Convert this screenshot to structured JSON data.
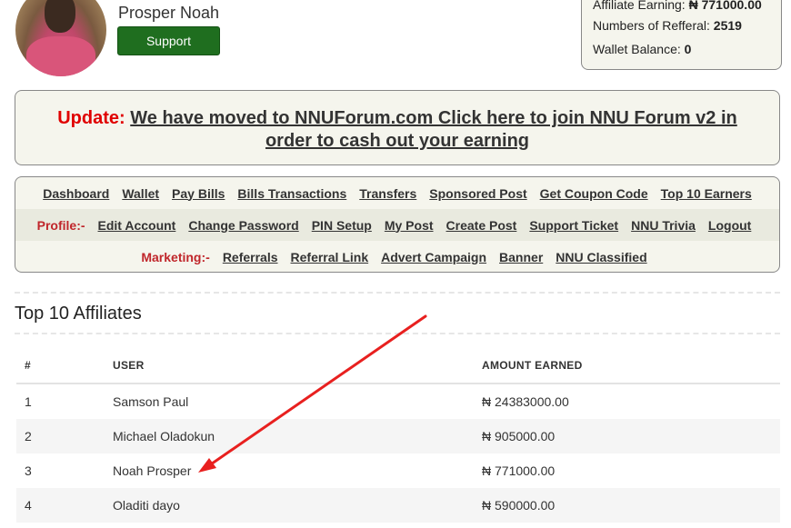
{
  "profile": {
    "name": "Prosper Noah",
    "support_label": "Support"
  },
  "stats": {
    "affiliate_label": "Affiliate Earning:",
    "affiliate_value": "₦ 771000.00",
    "referral_label": "Numbers of Refferal:",
    "referral_value": "2519",
    "wallet_label": "Wallet Balance:",
    "wallet_value": "0"
  },
  "update": {
    "label": "Update:",
    "link_line1": "We have moved to NNUForum.com Click here to join NNU Forum v2 in",
    "link_line2": "order to cash out your earning"
  },
  "menu": {
    "row1": [
      "Dashboard",
      "Wallet",
      "Pay Bills",
      "Bills Transactions",
      "Transfers",
      "Sponsored Post",
      "Get Coupon Code",
      "Top 10 Earners"
    ],
    "profile_label": "Profile:-",
    "row2": [
      "Edit Account",
      "Change Password",
      "PIN Setup",
      "My Post",
      "Create Post",
      "Support Ticket",
      "NNU Trivia",
      "Logout"
    ],
    "marketing_label": "Marketing:-",
    "row3": [
      "Referrals",
      "Referral Link",
      "Advert Campaign",
      "Banner",
      "NNU Classified"
    ]
  },
  "affiliates": {
    "title": "Top 10 Affiliates",
    "headers": [
      "#",
      "USER",
      "AMOUNT EARNED"
    ],
    "rows": [
      {
        "rank": "1",
        "user": "Samson Paul",
        "amount": "₦ 24383000.00"
      },
      {
        "rank": "2",
        "user": "Michael Oladokun",
        "amount": "₦ 905000.00"
      },
      {
        "rank": "3",
        "user": "Noah Prosper",
        "amount": "₦ 771000.00"
      },
      {
        "rank": "4",
        "user": "Oladiti dayo",
        "amount": "₦ 590000.00"
      }
    ]
  },
  "colors": {
    "support_button": "#1f6e1f",
    "update_label": "#e00000",
    "menu_label": "#c0262b",
    "annotation_arrow": "#e8201f"
  }
}
